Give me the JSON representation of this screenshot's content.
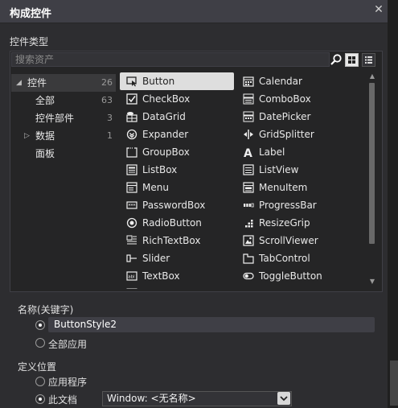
{
  "dialog": {
    "title": "构成控件",
    "close_glyph": "✕"
  },
  "section_label": "控件类型",
  "search": {
    "placeholder": "搜索资产",
    "icon": "search-icon"
  },
  "view_toggles": [
    {
      "icon": "grid-view-icon",
      "active": true
    },
    {
      "icon": "list-view-icon",
      "active": false
    }
  ],
  "categories": [
    {
      "label": "控件",
      "count": "26",
      "expander": "◢",
      "selected": true
    },
    {
      "label": "全部",
      "count": "63"
    },
    {
      "label": "控件部件",
      "count": "3"
    },
    {
      "label": "数据",
      "count": "1",
      "expander": "▷"
    },
    {
      "label": "面板",
      "count": ""
    }
  ],
  "controls": {
    "left": [
      {
        "label": "Button",
        "icon": "button-icon",
        "selected": true
      },
      {
        "label": "CheckBox",
        "icon": "checkbox-icon"
      },
      {
        "label": "DataGrid",
        "icon": "datagrid-icon"
      },
      {
        "label": "Expander",
        "icon": "expander-icon"
      },
      {
        "label": "GroupBox",
        "icon": "groupbox-icon"
      },
      {
        "label": "ListBox",
        "icon": "listbox-icon"
      },
      {
        "label": "Menu",
        "icon": "menu-icon"
      },
      {
        "label": "PasswordBox",
        "icon": "passwordbox-icon"
      },
      {
        "label": "RadioButton",
        "icon": "radiobutton-icon"
      },
      {
        "label": "RichTextBox",
        "icon": "richtextbox-icon"
      },
      {
        "label": "Slider",
        "icon": "slider-icon"
      },
      {
        "label": "TextBox",
        "icon": "textbox-icon"
      }
    ],
    "right": [
      {
        "label": "Calendar",
        "icon": "calendar-icon"
      },
      {
        "label": "ComboBox",
        "icon": "combobox-icon"
      },
      {
        "label": "DatePicker",
        "icon": "datepicker-icon"
      },
      {
        "label": "GridSplitter",
        "icon": "gridsplitter-icon"
      },
      {
        "label": "Label",
        "icon": "label-icon"
      },
      {
        "label": "ListView",
        "icon": "listview-icon"
      },
      {
        "label": "MenuItem",
        "icon": "menuitem-icon"
      },
      {
        "label": "ProgressBar",
        "icon": "progressbar-icon"
      },
      {
        "label": "ResizeGrip",
        "icon": "resizegrip-icon"
      },
      {
        "label": "ScrollViewer",
        "icon": "scrollviewer-icon"
      },
      {
        "label": "TabControl",
        "icon": "tabcontrol-icon"
      },
      {
        "label": "ToggleButton",
        "icon": "togglebutton-icon"
      }
    ]
  },
  "scrollbar": {
    "up": "▲",
    "down": "▼"
  },
  "name_section": {
    "label": "名称(关键字)",
    "value": "ButtonStyle2",
    "apply_all_label": "全部应用",
    "selected": "name"
  },
  "define_section": {
    "label": "定义位置",
    "application_label": "应用程序",
    "this_document_label": "此文档",
    "selected": "this_document",
    "document_value": "Window: <无名称>"
  }
}
